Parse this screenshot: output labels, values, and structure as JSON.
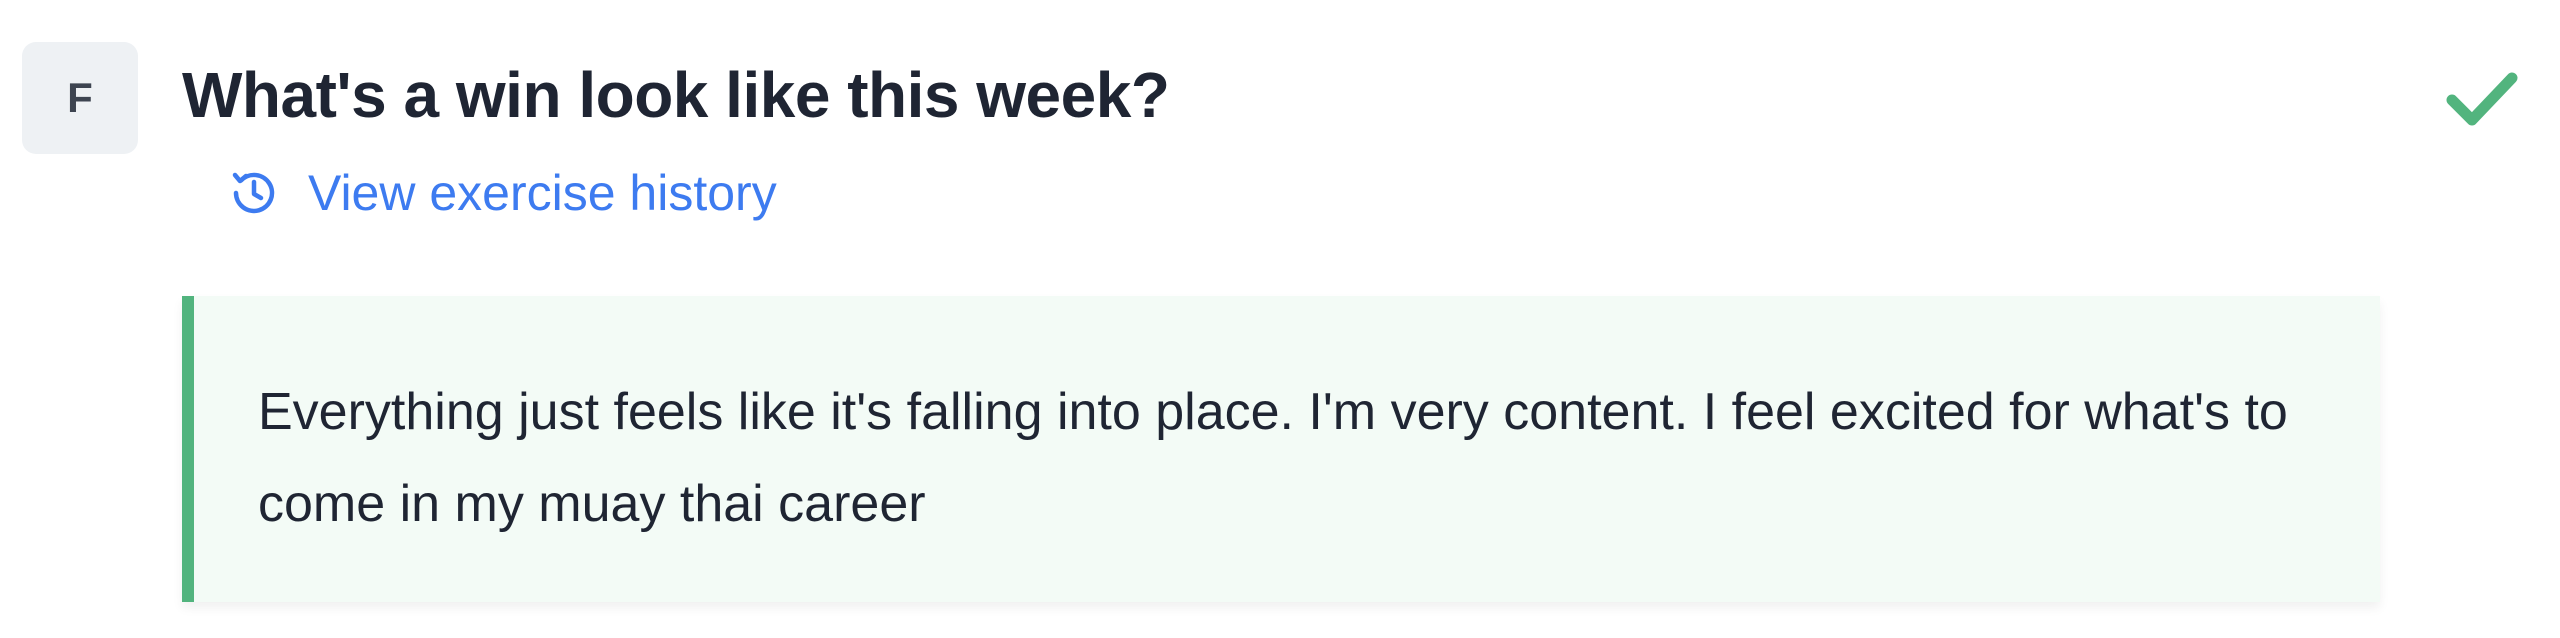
{
  "avatar": {
    "initial": "F"
  },
  "question": {
    "title": "What's a win look like this week?"
  },
  "history": {
    "label": "View exercise history",
    "icon": "history-icon"
  },
  "status": {
    "icon": "check-icon",
    "color": "#52b47e"
  },
  "answer": {
    "text": "Everything just feels like it's falling into place. I'm very content. I feel excited for what's to come in my muay thai career",
    "accent_color": "#52b47e"
  },
  "colors": {
    "link": "#3d7bf0",
    "text": "#1f2533",
    "answer_bg": "#f3fbf6"
  }
}
